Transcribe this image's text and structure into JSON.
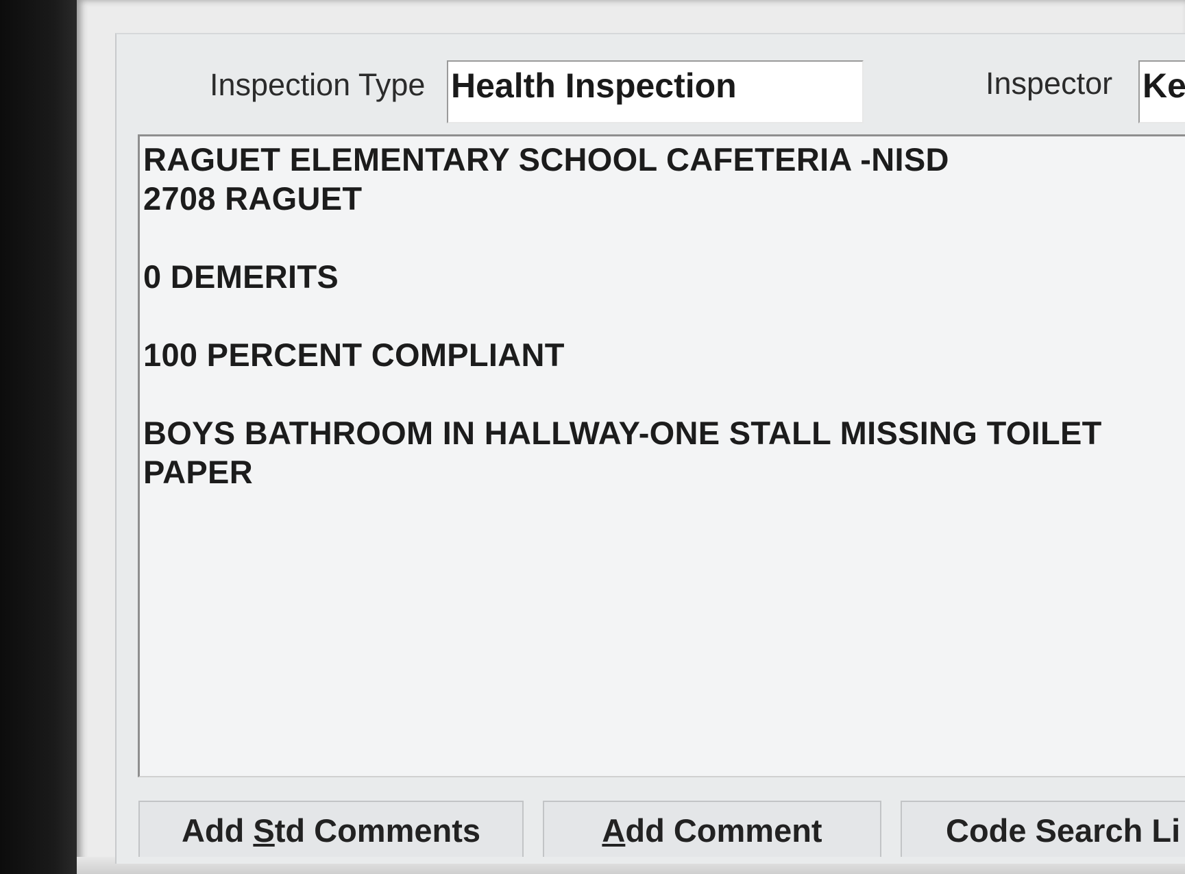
{
  "header": {
    "inspection_type_label": "Inspection Type",
    "inspection_type_value": "Health Inspection",
    "inspector_label": "Inspector",
    "inspector_value": "Ke"
  },
  "comments": {
    "lines": [
      "RAGUET ELEMENTARY SCHOOL CAFETERIA -NISD",
      "2708 RAGUET",
      "",
      "0 DEMERITS",
      "",
      "100 PERCENT COMPLIANT",
      "",
      "BOYS BATHROOM IN HALLWAY-ONE STALL MISSING TOILET",
      "PAPER"
    ]
  },
  "buttons": {
    "add_std_comments": {
      "before": "Add ",
      "mnemonic": "S",
      "after": "td Comments"
    },
    "add_comment": {
      "before": "",
      "mnemonic": "A",
      "after": "dd Comment"
    },
    "code_search": {
      "label": "Code Search Li"
    }
  }
}
